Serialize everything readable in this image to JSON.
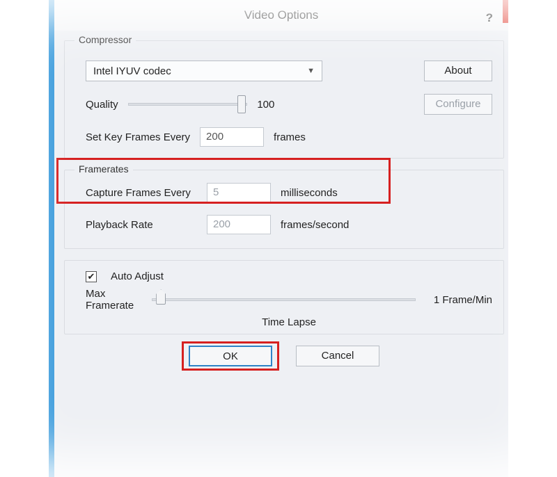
{
  "window": {
    "title": "Video Options",
    "help": "?"
  },
  "compressor": {
    "legend": "Compressor",
    "codec": "Intel IYUV codec",
    "about_label": "About",
    "configure_label": "Configure",
    "quality_label": "Quality",
    "quality_value": "100",
    "keyframe_label": "Set Key Frames Every",
    "keyframe_value": "200",
    "keyframe_unit": "frames"
  },
  "framerates": {
    "legend": "Framerates",
    "capture_label": "Capture Frames Every",
    "capture_value": "5",
    "capture_unit": "milliseconds",
    "playback_label": "Playback Rate",
    "playback_value": "200",
    "playback_unit": "frames/second"
  },
  "autoadjust": {
    "checkbox_label": "Auto Adjust",
    "checkbox_checked": true,
    "max_label_line1": "Max",
    "max_label_line2": "Framerate",
    "right_label": "1 Frame/Min",
    "bottom_label": "Time Lapse"
  },
  "buttons": {
    "ok": "OK",
    "cancel": "Cancel"
  }
}
